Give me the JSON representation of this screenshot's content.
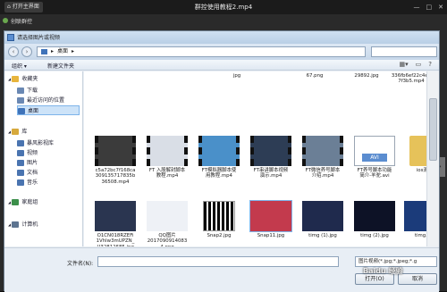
{
  "player": {
    "open_label": "打开主界面",
    "title": "群控使用教程2.mp4",
    "outer_title": "创联群控"
  },
  "dialog": {
    "title": "请选择图片或视频",
    "path": [
      "桌面"
    ],
    "toolbar": {
      "organize": "组织 ▾",
      "new_folder": "新建文件夹"
    },
    "sidebar": [
      {
        "label": "收藏夹",
        "icon": "star-icon",
        "color": "#e7b43c",
        "level": 0
      },
      {
        "label": "下载",
        "icon": "download-folder-icon",
        "color": "#6a88b3",
        "level": 1
      },
      {
        "label": "最近访问的位置",
        "icon": "recent-places-icon",
        "color": "#6a88b3",
        "level": 1
      },
      {
        "label": "桌面",
        "icon": "desktop-icon",
        "color": "#3f73b9",
        "level": 1,
        "selected": true
      },
      {
        "label": "库",
        "icon": "library-icon",
        "color": "#d7a93c",
        "level": 0
      },
      {
        "label": "暴风影视库",
        "icon": "video-library-icon",
        "color": "#4a74b0",
        "level": 1
      },
      {
        "label": "视频",
        "icon": "video-folder-icon",
        "color": "#4a74b0",
        "level": 1
      },
      {
        "label": "图片",
        "icon": "picture-folder-icon",
        "color": "#4a74b0",
        "level": 1
      },
      {
        "label": "文档",
        "icon": "document-folder-icon",
        "color": "#4a74b0",
        "level": 1
      },
      {
        "label": "音乐",
        "icon": "music-folder-icon",
        "color": "#4a74b0",
        "level": 1
      },
      {
        "label": "家庭组",
        "icon": "homegroup-icon",
        "color": "#3c8f4a",
        "level": 0
      },
      {
        "label": "计算机",
        "icon": "computer-icon",
        "color": "#5d7490",
        "level": 0
      }
    ],
    "top_row": [
      {
        "label": "jpg"
      },
      {
        "label": "67.png"
      },
      {
        "label": "29892.jpg"
      },
      {
        "label": "336fb6ef22c4e2\n7f3b5.mp4"
      }
    ],
    "files": [
      {
        "label": "c5a72bc7f168ca\n309135717835b\n36508.mp4",
        "kind": "video",
        "thumb": "#3b3b3b"
      },
      {
        "label": "FT 入股解封脚本\n教程.mp4",
        "kind": "video",
        "thumb": "#d9dee6"
      },
      {
        "label": "FT模拟器脚本使\n用教程.mp4",
        "kind": "video",
        "thumb": "#4a90c9"
      },
      {
        "label": "FT串讲脚本视频\n演示.mp4",
        "kind": "video",
        "thumb": "#2d3d55"
      },
      {
        "label": "FT微信养号脚本\n介绍.mp4",
        "kind": "video",
        "thumb": "#6b7f96"
      },
      {
        "label": "FT养号脚本功能\n简介-羊驼.avi",
        "kind": "avi",
        "thumb": "#5b8dd0"
      },
      {
        "label": "ios测试",
        "kind": "folder",
        "thumb": "#e6c25a"
      },
      {
        "label": "O1CN018RZEFi\n1Vhlw3mUPZN_\n!!32812685.jpg",
        "kind": "image",
        "thumb": "#2a3550"
      },
      {
        "label": "QQ图片\n2017090914083\n4.png",
        "kind": "image",
        "thumb": "#eef1f6"
      },
      {
        "label": "Snap2.jpg",
        "kind": "qr",
        "thumb": "#ffffff"
      },
      {
        "label": "Snap11.jpg",
        "kind": "image",
        "thumb": "#c33a4d"
      },
      {
        "label": "timg (1).jpg",
        "kind": "image",
        "thumb": "#1f2a4d"
      },
      {
        "label": "timg (2).jpg",
        "kind": "image",
        "thumb": "#0d1226"
      },
      {
        "label": "timg.jpg",
        "kind": "image",
        "thumb": "#1b3b7a"
      }
    ],
    "filename_label": "文件名(N):",
    "filename_value": "",
    "file_type": "图片视频(*.jpg;*.jpeg;*.g",
    "open_button": "打开(O)",
    "cancel_button": "取消"
  },
  "watermark": "Baidu 经验"
}
